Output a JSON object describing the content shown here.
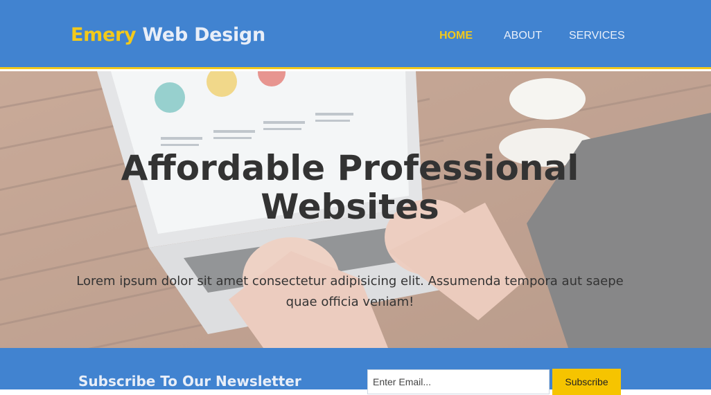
{
  "header": {
    "logo": {
      "accent": "Emery",
      "rest": " Web Design"
    },
    "nav": [
      {
        "label": "Home",
        "active": true
      },
      {
        "label": "About",
        "active": false
      },
      {
        "label": "Services",
        "active": false
      }
    ]
  },
  "hero": {
    "title": "Affordable Professional Websites",
    "text": "Lorem ipsum dolor sit amet consectetur adipisicing elit. Assumenda tempora aut saepe quae officia veniam!"
  },
  "newsletter": {
    "title": "Subscribe To Our Newsletter",
    "email_placeholder": "Enter Email...",
    "button": "Subscribe"
  },
  "colors": {
    "brand_blue": "#4183d0",
    "accent_yellow": "#f2c91b",
    "button_yellow": "#f6c400"
  }
}
